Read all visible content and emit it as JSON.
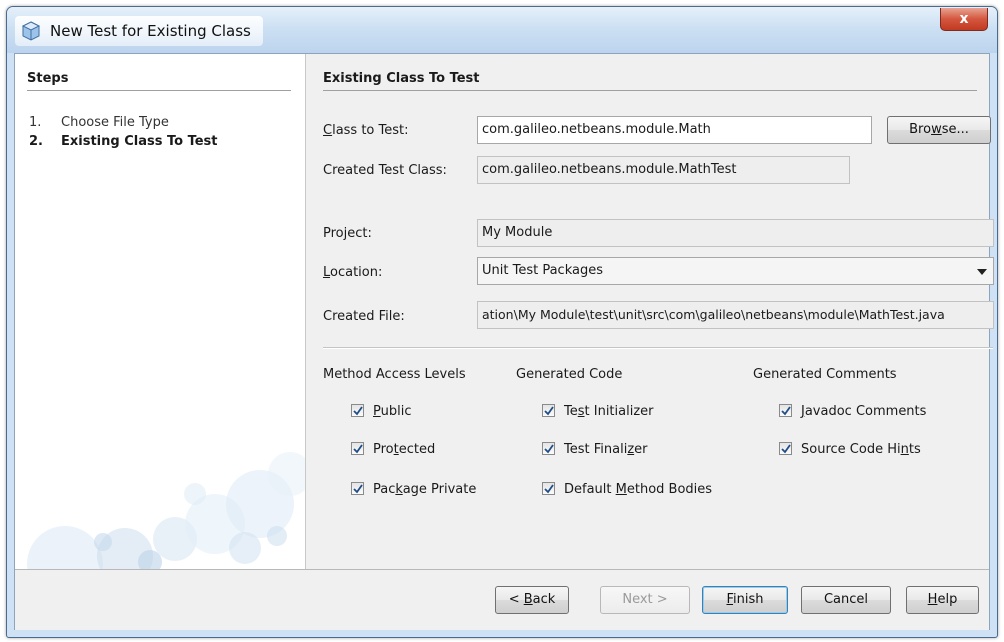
{
  "window": {
    "title": "New Test for Existing Class",
    "close_label": "x"
  },
  "steps": {
    "header": "Steps",
    "items": [
      {
        "num": "1.",
        "label": "Choose File Type"
      },
      {
        "num": "2.",
        "label": "Existing Class To Test"
      }
    ]
  },
  "panel": {
    "header": "Existing Class To Test",
    "class_to_test": {
      "label_pre": "",
      "label_mn": "C",
      "label_post": "lass to Test:",
      "value": "com.galileo.netbeans.module.Math"
    },
    "browse": {
      "pre": "Bro",
      "mn": "w",
      "post": "se..."
    },
    "created_test_class": {
      "label": "Created Test Class:",
      "value": "com.galileo.netbeans.module.MathTest"
    },
    "project": {
      "label": "Project:",
      "value": "My Module"
    },
    "location": {
      "label_mn": "L",
      "label_post": "ocation:",
      "value": "Unit Test Packages"
    },
    "created_file": {
      "label": "Created File:",
      "value": "ation\\My Module\\test\\unit\\src\\com\\galileo\\netbeans\\module\\MathTest.java"
    }
  },
  "method_access": {
    "title": "Method Access Levels",
    "public": {
      "mn": "P",
      "post": "ublic",
      "checked": true
    },
    "protected": {
      "pre": "Pro",
      "mn": "t",
      "post": "ected",
      "checked": true
    },
    "package_private": {
      "pre": "Pac",
      "mn": "k",
      "post": "age Private",
      "checked": true
    }
  },
  "generated_code": {
    "title": "Generated Code",
    "test_initializer": {
      "pre": "Te",
      "mn": "s",
      "post": "t Initializer",
      "checked": true
    },
    "test_finalizer": {
      "pre": "Test Finali",
      "mn": "z",
      "post": "er",
      "checked": true
    },
    "default_method_bodies": {
      "pre": "Default ",
      "mn": "M",
      "post": "ethod Bodies",
      "checked": true
    }
  },
  "generated_comments": {
    "title": "Generated Comments",
    "javadoc": {
      "mn": "J",
      "post": "avadoc Comments",
      "checked": true
    },
    "source_hints": {
      "pre": "Source Code Hi",
      "mn": "n",
      "post": "ts",
      "checked": true
    }
  },
  "buttons": {
    "back": {
      "pre": "< ",
      "mn": "B",
      "post": "ack"
    },
    "next": "Next >",
    "finish": {
      "mn": "F",
      "post": "inish"
    },
    "cancel": "Cancel",
    "help": {
      "mn": "H",
      "post": "elp"
    }
  },
  "colors": {
    "title_bar": "#cde0f3",
    "close_button": "#d4563e",
    "default_button_border": "#3c7fb1"
  },
  "icons": [
    "netbeans-cube-icon",
    "checkbox-checked-icon",
    "dropdown-arrow-icon",
    "close-icon"
  ]
}
